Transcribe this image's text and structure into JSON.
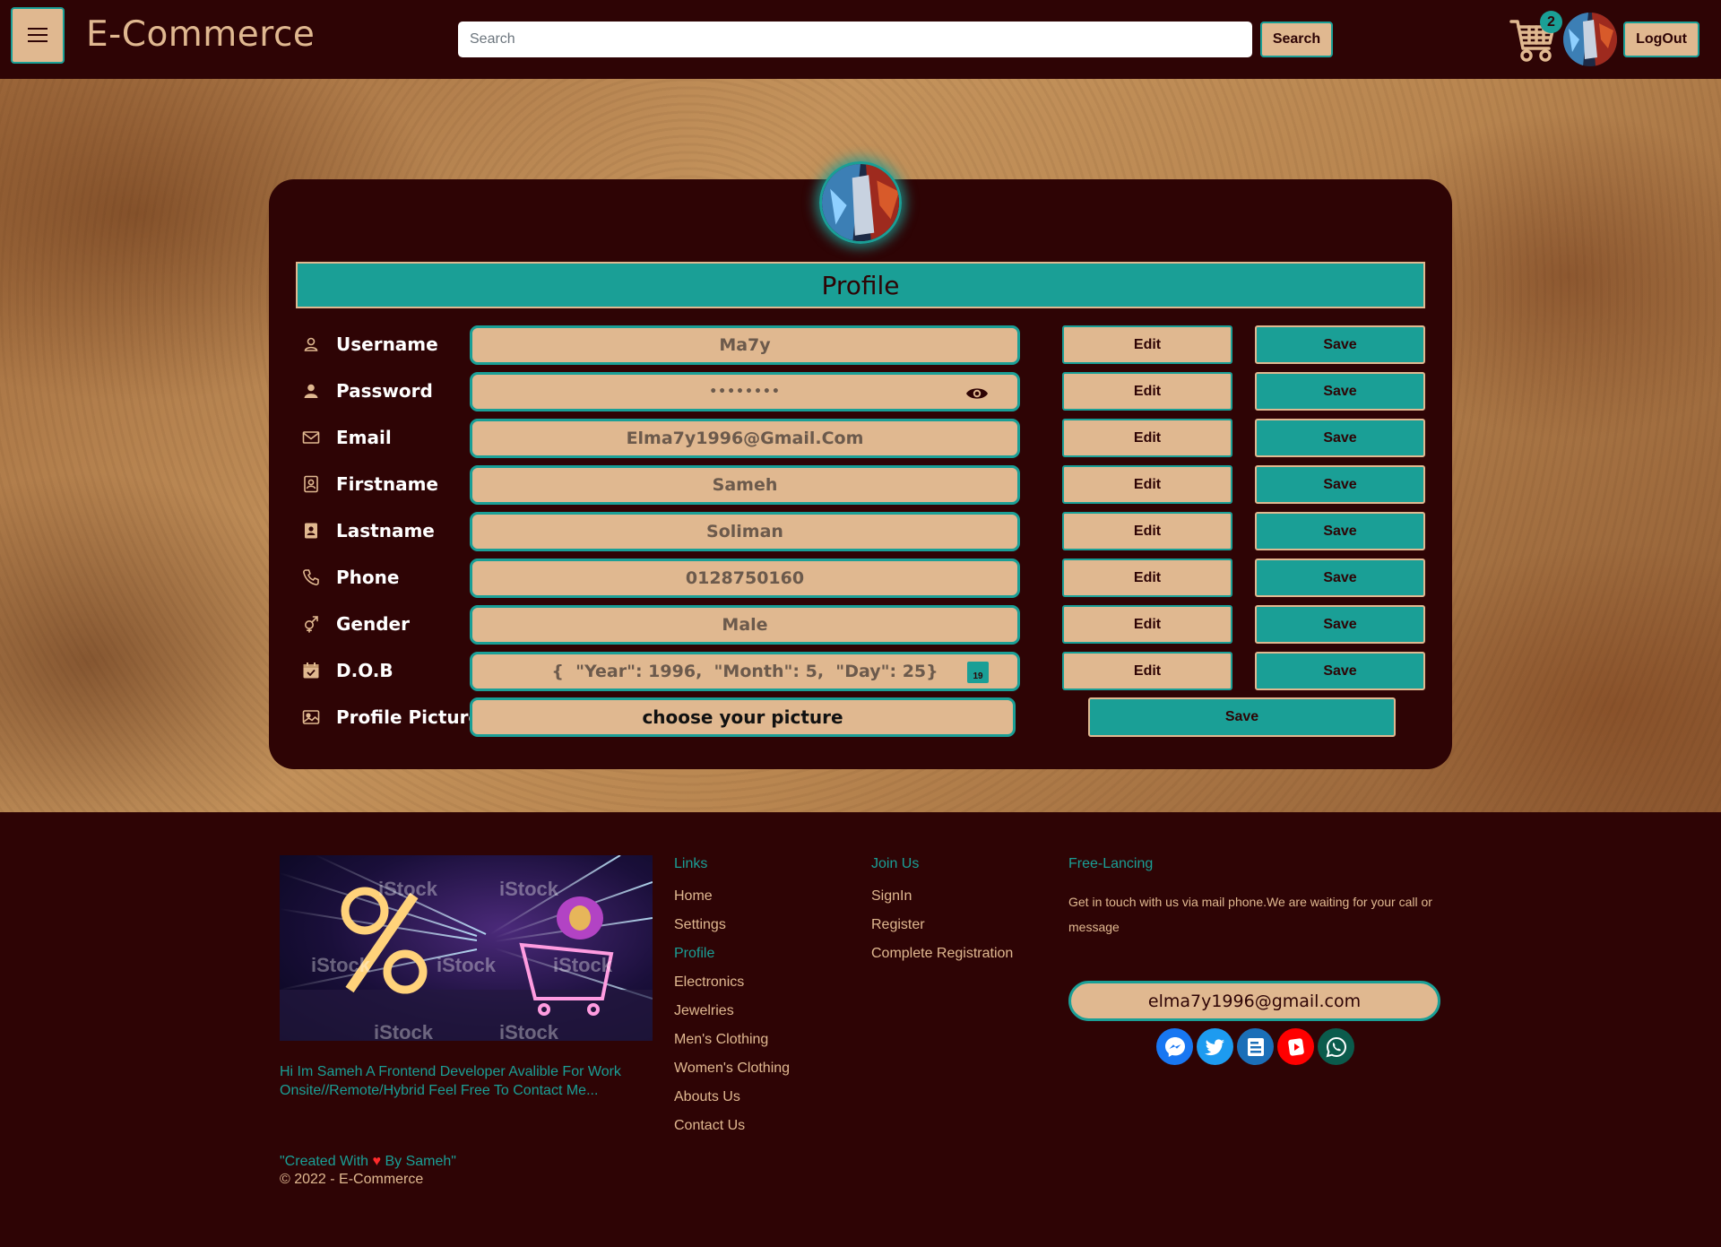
{
  "header": {
    "brand": "E-Commerce",
    "search_placeholder": "Search",
    "search_button": "Search",
    "cart_count": "2",
    "logout_button": "LogOut"
  },
  "profile": {
    "title": "Profile",
    "rows": [
      {
        "label": "Username",
        "value": "Ma7y",
        "icon": "user-outline-icon"
      },
      {
        "label": "Password",
        "value": "••••••••",
        "icon": "user-solid-icon"
      },
      {
        "label": "Email",
        "value": "Elma7y1996@Gmail.Com",
        "icon": "envelope-icon"
      },
      {
        "label": "Firstname",
        "value": "Sameh",
        "icon": "contact-card-icon"
      },
      {
        "label": "Lastname",
        "value": "Soliman",
        "icon": "contact-card-solid-icon"
      },
      {
        "label": "Phone",
        "value": "0128750160",
        "icon": "phone-icon"
      },
      {
        "label": "Gender",
        "value": "Male",
        "icon": "gender-icon"
      },
      {
        "label": "D.O.B",
        "value": "{  \"Year\": 1996,  \"Month\": 5,  \"Day\": 25}",
        "icon": "calendar-icon"
      }
    ],
    "edit_label": "Edit",
    "save_label": "Save",
    "picture_label": "Profile Picture",
    "picture_button": "choose your picture",
    "picture_save": "Save",
    "calendar_day": "19"
  },
  "footer": {
    "about": "Hi Im Sameh A Frontend Developer Avalible For Work Onsite//Remote/Hybrid Feel Free To Contact Me...",
    "created_prefix": "\"Created With ",
    "heart": "♥",
    "created_suffix": " By Sameh\"",
    "copyright": "© 2022 - E-Commerce",
    "links_heading": "Links",
    "links": [
      "Home",
      "Settings",
      "Profile",
      "Electronics",
      "Jewelries",
      "Men's Clothing",
      "Women's Clothing",
      "Abouts Us",
      "Contact Us"
    ],
    "join_heading": "Join Us",
    "join_links": [
      "SignIn",
      "Register",
      "Complete Registration"
    ],
    "free_heading": "Free-Lancing",
    "free_text": "Get in touch with us via mail phone.We are waiting for your call or message",
    "email": "elma7y1996@gmail.com",
    "promo_watermark": "iStock",
    "socials": [
      {
        "name": "messenger-icon",
        "color": "#1877f2"
      },
      {
        "name": "twitter-icon",
        "color": "#1d9bf0"
      },
      {
        "name": "blogger-icon",
        "color": "#1b6fb8"
      },
      {
        "name": "youtube-icon",
        "color": "#ff0000"
      },
      {
        "name": "whatsapp-icon",
        "color": "#0b5b4c"
      }
    ]
  },
  "colors": {
    "background": "#2e0405",
    "accent": "#1a9f96",
    "sand": "#e0b890"
  }
}
